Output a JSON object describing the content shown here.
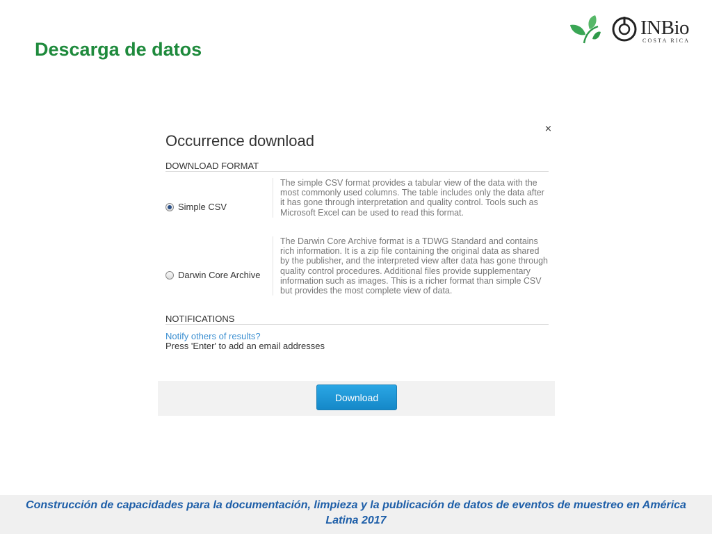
{
  "slide": {
    "title": "Descarga de datos",
    "footer": "Construcción de capacidades para la documentación, limpieza y la publicación de datos de eventos de muestreo en América Latina 2017"
  },
  "logo": {
    "name": "INBio",
    "subtitle": "COSTA RICA",
    "icons": [
      "leaf-icon",
      "inbio-mark-icon"
    ]
  },
  "dialog": {
    "title": "Occurrence download",
    "close_label": "×",
    "format_heading": "DOWNLOAD FORMAT",
    "options": [
      {
        "label": "Simple CSV",
        "selected": true,
        "description": "The simple CSV format provides a tabular view of the data with the most commonly used columns. The table includes only the data after it has gone through interpretation and quality control. Tools such as Microsoft Excel can be used to read this format."
      },
      {
        "label": "Darwin Core Archive",
        "selected": false,
        "description": "The Darwin Core Archive format is a TDWG Standard and contains rich information. It is a zip file containing the original data as shared by the publisher, and the interpreted view after data has gone through quality control procedures. Additional files provide supplementary information such as images. This is a richer format than simple CSV but provides the most complete view of data."
      }
    ],
    "notifications_heading": "NOTIFICATIONS",
    "notify_link": "Notify others of results?",
    "notify_hint": "Press 'Enter' to add an email addresses",
    "download_label": "Download"
  },
  "colors": {
    "title_green": "#1e8a3c",
    "footer_blue": "#1d5ea8",
    "button_blue": "#1b97d6",
    "link_blue": "#3b8fd1"
  }
}
